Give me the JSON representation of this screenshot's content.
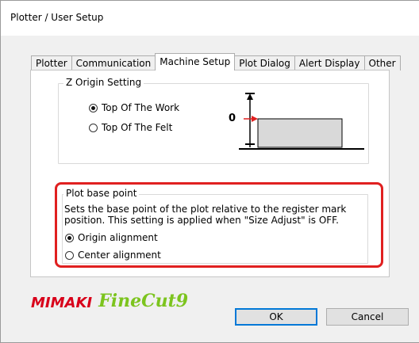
{
  "window": {
    "title": "Plotter / User Setup"
  },
  "tabs": [
    {
      "label": "Plotter",
      "active": false
    },
    {
      "label": "Communication",
      "active": false
    },
    {
      "label": "Machine Setup",
      "active": true
    },
    {
      "label": "Plot Dialog",
      "active": false
    },
    {
      "label": "Alert Display",
      "active": false
    },
    {
      "label": "Other",
      "active": false
    }
  ],
  "z_origin": {
    "title": "Z Origin Setting",
    "options": [
      {
        "label": "Top Of The Work",
        "selected": true
      },
      {
        "label": "Top Of The Felt",
        "selected": false
      }
    ],
    "diagram_zero_label": "0"
  },
  "plot_base": {
    "title": "Plot base point",
    "description": "Sets the base point of the plot relative to the register mark position. This setting is applied when \"Size Adjust\" is OFF.",
    "options": [
      {
        "label": "Origin alignment",
        "selected": true
      },
      {
        "label": "Center alignment",
        "selected": false
      }
    ]
  },
  "logo": {
    "brand": "MIMAKI",
    "product": "FineCut9"
  },
  "buttons": {
    "ok": "OK",
    "cancel": "Cancel"
  },
  "colors": {
    "highlight": "#e02020",
    "arrow": "#e02020",
    "brand_red": "#d8001a",
    "brand_green": "#7cc41e"
  }
}
